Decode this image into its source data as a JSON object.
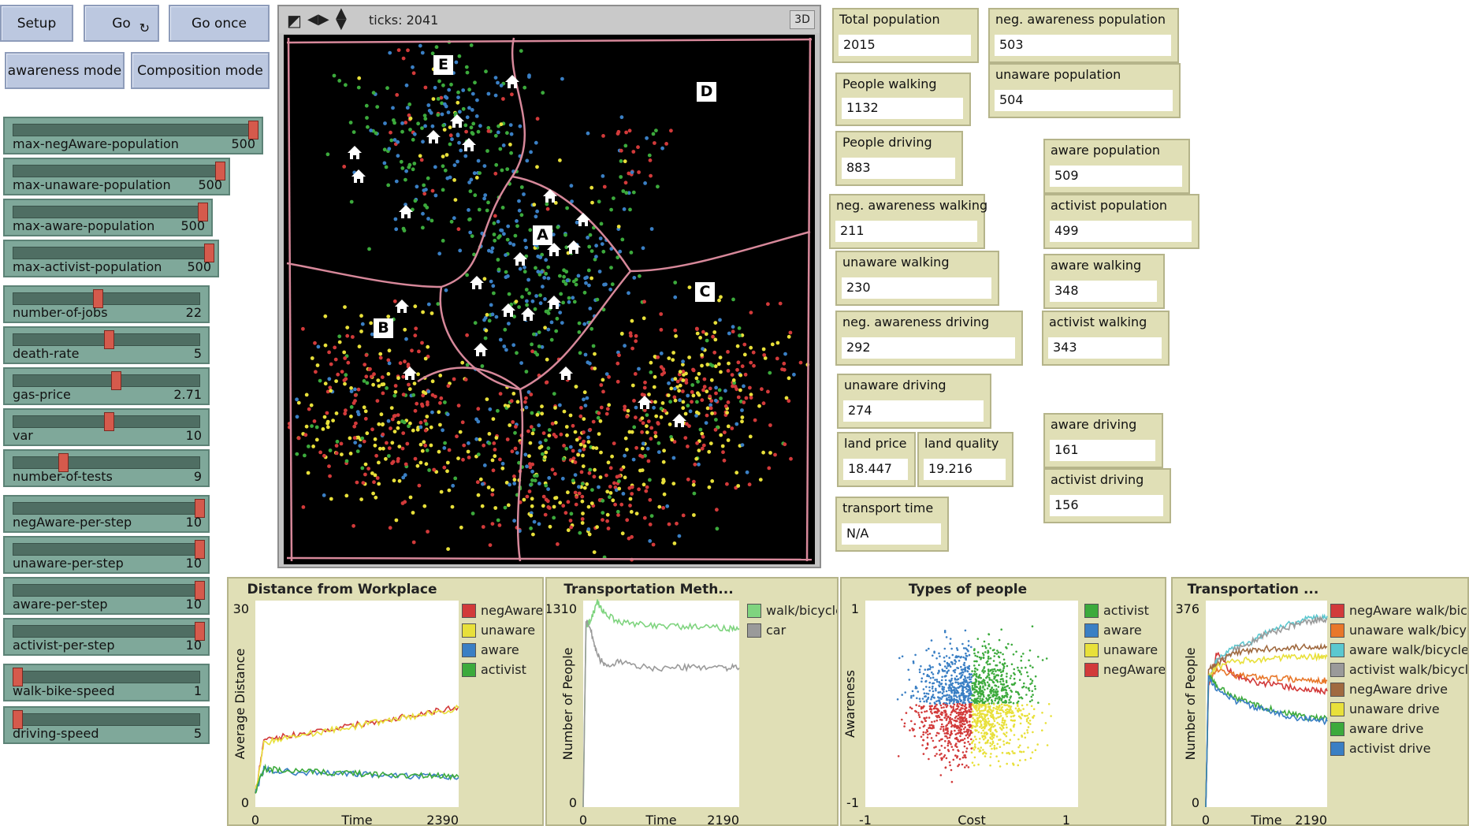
{
  "buttons": {
    "setup": "Setup",
    "go": "Go",
    "go_once": "Go once",
    "awareness_mode": "awareness mode",
    "composition_mode": "Composition mode"
  },
  "sliders": [
    {
      "label": "max-negAware-population",
      "value": "500",
      "fraction": 1.0
    },
    {
      "label": "max-unaware-population",
      "value": "500",
      "fraction": 1.0
    },
    {
      "label": "max-aware-population",
      "value": "500",
      "fraction": 1.0
    },
    {
      "label": "max-activist-population",
      "value": "500",
      "fraction": 1.0
    },
    {
      "label": "number-of-jobs",
      "value": "22",
      "fraction": 0.44
    },
    {
      "label": "death-rate",
      "value": "5",
      "fraction": 0.5
    },
    {
      "label": "gas-price",
      "value": "2.71",
      "fraction": 0.54
    },
    {
      "label": "var",
      "value": "10",
      "fraction": 0.5
    },
    {
      "label": "number-of-tests",
      "value": "9",
      "fraction": 0.25
    },
    {
      "label": "negAware-per-step",
      "value": "10",
      "fraction": 1.0
    },
    {
      "label": "unaware-per-step",
      "value": "10",
      "fraction": 1.0
    },
    {
      "label": "aware-per-step",
      "value": "10",
      "fraction": 1.0
    },
    {
      "label": "activist-per-step",
      "value": "10",
      "fraction": 1.0
    },
    {
      "label": "walk-bike-speed",
      "value": "1",
      "fraction": 0.0
    },
    {
      "label": "driving-speed",
      "value": "5",
      "fraction": 0.0
    }
  ],
  "view": {
    "ticks": "ticks: 2041",
    "three_d": "3D",
    "region_labels": [
      "E",
      "D",
      "A",
      "C",
      "B"
    ]
  },
  "monitors": [
    {
      "label": "Total population",
      "value": "2015"
    },
    {
      "label": "neg. awareness population",
      "value": "503"
    },
    {
      "label": "unaware population",
      "value": "504"
    },
    {
      "label": "People walking",
      "value": "1132"
    },
    {
      "label": "People driving",
      "value": "883"
    },
    {
      "label": "aware population",
      "value": "509"
    },
    {
      "label": "activist population",
      "value": "499"
    },
    {
      "label": "neg. awareness walking",
      "value": "211"
    },
    {
      "label": "unaware walking",
      "value": "230"
    },
    {
      "label": "aware walking",
      "value": "348"
    },
    {
      "label": "activist walking",
      "value": "343"
    },
    {
      "label": "neg. awareness driving",
      "value": "292"
    },
    {
      "label": "unaware driving",
      "value": "274"
    },
    {
      "label": "land price",
      "value": "18.447"
    },
    {
      "label": "land quality",
      "value": "19.216"
    },
    {
      "label": "aware driving",
      "value": "161"
    },
    {
      "label": "activist driving",
      "value": "156"
    },
    {
      "label": "transport time",
      "value": "N/A"
    }
  ],
  "colors": {
    "negAware": "#d23a3a",
    "unaware": "#e8e03a",
    "aware": "#3a7fc4",
    "activist": "#3caa3c",
    "walk": "#7fd47f",
    "car": "#9a9a9a",
    "road": "#d7889a"
  },
  "plots": {
    "distance": {
      "title": "Distance from Workplace",
      "ylabel": "Average Distance",
      "xlabel": "Time",
      "ymin": "0",
      "ymax": "30",
      "xmin": "0",
      "xmax": "2390",
      "legend": [
        "negAware",
        "unaware",
        "aware",
        "activist"
      ]
    },
    "transport": {
      "title": "Transportation Meth...",
      "ylabel": "Number of People",
      "xlabel": "Time",
      "ymin": "0",
      "ymax": "1310",
      "xmin": "0",
      "xmax": "2190",
      "legend": [
        "walk/bicycle",
        "car"
      ]
    },
    "types": {
      "title": "Types of people",
      "ylabel": "Awareness",
      "xlabel": "Cost",
      "ymin": "-1",
      "ymax": "1",
      "xmin": "-1",
      "xmax": "1",
      "legend": [
        "activist",
        "aware",
        "unaware",
        "negAware"
      ]
    },
    "transport2": {
      "title": "Transportation ...",
      "ylabel": "Number of People",
      "xlabel": "Time",
      "ymin": "0",
      "ymax": "376",
      "xmin": "0",
      "xmax": "2190",
      "legend": [
        "negAware walk/bicyc",
        "unaware walk/bicycle",
        "aware walk/bicycle",
        "activist walk/bicycle",
        "negAware drive",
        "unaware drive",
        "aware drive",
        "activist drive"
      ]
    }
  },
  "chart_data": [
    {
      "type": "line",
      "title": "Distance from Workplace",
      "xlabel": "Time",
      "ylabel": "Average Distance",
      "xlim": [
        0,
        2390
      ],
      "ylim": [
        0,
        30
      ],
      "x": [
        0,
        100,
        300,
        600,
        900,
        1200,
        1500,
        1800,
        2100,
        2390
      ],
      "series": [
        {
          "name": "negAware",
          "values": [
            2,
            9.5,
            10.2,
            10.8,
            11.4,
            12,
            12.6,
            13.3,
            13.9,
            14.6
          ]
        },
        {
          "name": "unaware",
          "values": [
            2,
            9.3,
            10,
            10.6,
            11.2,
            11.8,
            12.5,
            13.1,
            13.7,
            14.4
          ]
        },
        {
          "name": "aware",
          "values": [
            2,
            5.5,
            5.2,
            5.0,
            4.9,
            4.8,
            4.6,
            4.5,
            4.4,
            4.3
          ]
        },
        {
          "name": "activist",
          "values": [
            2,
            5.6,
            5.3,
            5.1,
            5.0,
            4.9,
            4.7,
            4.6,
            4.5,
            4.4
          ]
        }
      ]
    },
    {
      "type": "line",
      "title": "Transportation Meth...",
      "xlabel": "Time",
      "ylabel": "Number of People",
      "xlim": [
        0,
        2190
      ],
      "ylim": [
        0,
        1310
      ],
      "x": [
        0,
        40,
        100,
        200,
        300,
        500,
        800,
        1100,
        1400,
        1700,
        2000,
        2190
      ],
      "series": [
        {
          "name": "walk/bicycle",
          "values": [
            0,
            1150,
            1180,
            1300,
            1230,
            1170,
            1160,
            1150,
            1145,
            1140,
            1135,
            1132
          ]
        },
        {
          "name": "car",
          "values": [
            0,
            1180,
            1130,
            960,
            900,
            920,
            890,
            880,
            885,
            890,
            885,
            883
          ]
        }
      ]
    },
    {
      "type": "scatter",
      "title": "Types of people",
      "xlabel": "Cost",
      "ylabel": "Awareness",
      "xlim": [
        -1,
        1
      ],
      "ylim": [
        -1,
        1
      ],
      "series": [
        {
          "name": "activist",
          "region": [
            [
              0,
              1
            ],
            [
              0,
              1
            ]
          ]
        },
        {
          "name": "aware",
          "region": [
            [
              -1,
              0
            ],
            [
              0,
              1
            ]
          ]
        },
        {
          "name": "unaware",
          "region": [
            [
              0,
              1
            ],
            [
              -1,
              0
            ]
          ]
        },
        {
          "name": "negAware",
          "region": [
            [
              -1,
              0
            ],
            [
              -1,
              0
            ]
          ]
        }
      ]
    },
    {
      "type": "line",
      "title": "Transportation ...",
      "xlabel": "Time",
      "ylabel": "Number of People",
      "xlim": [
        0,
        2190
      ],
      "ylim": [
        0,
        376
      ],
      "x": [
        0,
        50,
        200,
        500,
        800,
        1100,
        1400,
        1700,
        2000,
        2190
      ],
      "series": [
        {
          "name": "negAware walk/bicyc",
          "values": [
            0,
            220,
            280,
            240,
            230,
            225,
            220,
            215,
            212,
            211
          ]
        },
        {
          "name": "unaware walk/bicycle",
          "values": [
            0,
            230,
            250,
            240,
            238,
            236,
            234,
            232,
            231,
            230
          ]
        },
        {
          "name": "aware walk/bicycle",
          "values": [
            0,
            230,
            270,
            290,
            300,
            320,
            330,
            340,
            345,
            348
          ]
        },
        {
          "name": "activist walk/bicycle",
          "values": [
            0,
            230,
            265,
            285,
            300,
            315,
            325,
            335,
            340,
            343
          ]
        },
        {
          "name": "negAware drive",
          "values": [
            0,
            250,
            260,
            280,
            285,
            288,
            290,
            291,
            292,
            292
          ]
        },
        {
          "name": "unaware drive",
          "values": [
            0,
            240,
            255,
            265,
            268,
            270,
            272,
            273,
            274,
            274
          ]
        },
        {
          "name": "aware drive",
          "values": [
            0,
            240,
            220,
            200,
            190,
            180,
            172,
            166,
            162,
            161
          ]
        },
        {
          "name": "activist drive",
          "values": [
            0,
            235,
            215,
            195,
            185,
            175,
            168,
            162,
            158,
            156
          ]
        }
      ]
    }
  ]
}
